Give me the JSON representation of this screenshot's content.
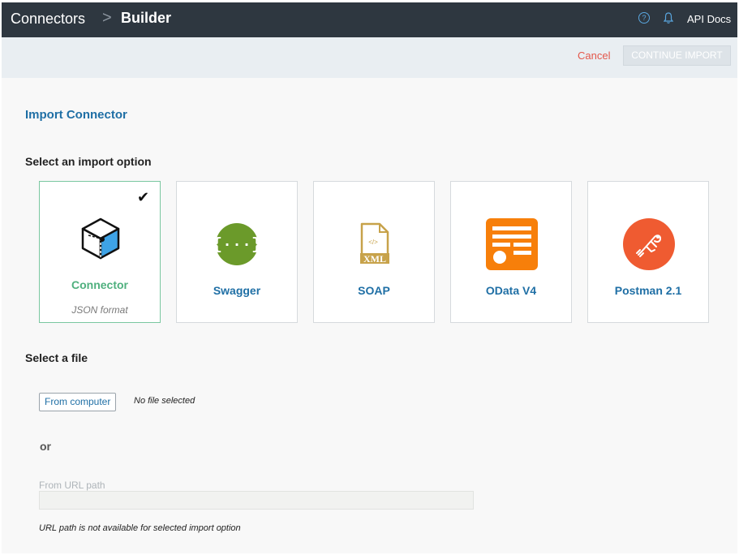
{
  "header": {
    "breadcrumb_root": "Connectors",
    "breadcrumb_separator": ">",
    "breadcrumb_current": "Builder",
    "help_icon_glyph": "?",
    "api_docs_label": "API Docs"
  },
  "actions": {
    "cancel_label": "Cancel",
    "continue_label": "CONTINUE IMPORT"
  },
  "page": {
    "title": "Import Connector",
    "import_section_label": "Select an import option",
    "file_section_label": "Select a file"
  },
  "options": [
    {
      "label": "Connector",
      "sub": "JSON format",
      "selected": true,
      "icon": "connector-cube-icon"
    },
    {
      "label": "Swagger",
      "sub": "",
      "selected": false,
      "icon": "swagger-icon"
    },
    {
      "label": "SOAP",
      "sub": "",
      "selected": false,
      "icon": "xml-file-icon"
    },
    {
      "label": "OData V4",
      "sub": "",
      "selected": false,
      "icon": "odata-icon"
    },
    {
      "label": "Postman 2.1",
      "sub": "",
      "selected": false,
      "icon": "postman-icon"
    }
  ],
  "file": {
    "button_label": "From computer",
    "status": "No file selected",
    "or_label": "or",
    "url_label": "From URL path",
    "url_value": "",
    "url_note": "URL path is not available for selected import option"
  },
  "colors": {
    "topbar": "#2e3740",
    "accent_blue": "#1f6fa5",
    "selected_green": "#4fb07e",
    "cancel_red": "#e4574b",
    "swagger_green": "#6b9a2a",
    "odata_orange": "#f77f0a",
    "postman_orange": "#ef5b31",
    "xml_gold": "#c7a24a"
  }
}
